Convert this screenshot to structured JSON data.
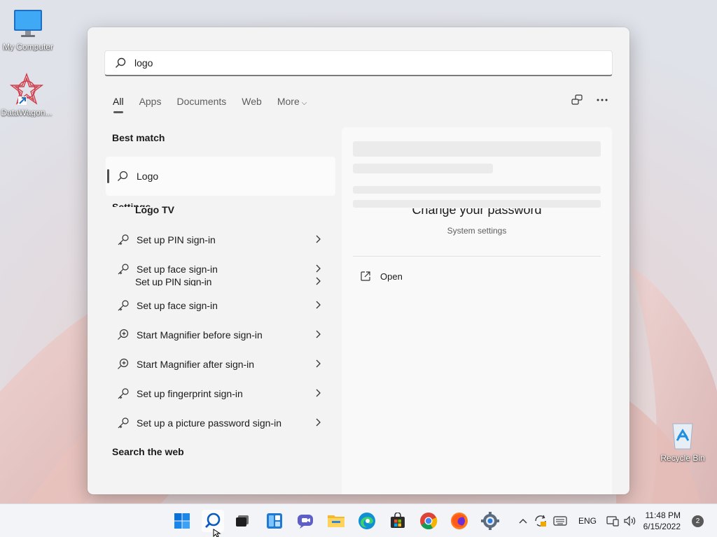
{
  "desktop": {
    "icons": [
      {
        "label": "My Computer",
        "icon": "monitor-icon"
      },
      {
        "label": "DataWagon...",
        "icon": "datawagon-icon"
      },
      {
        "label": "Recycle Bin",
        "icon": "recycle-bin-icon"
      }
    ]
  },
  "search": {
    "query": "logo",
    "tabs": [
      {
        "label": "All",
        "active": true
      },
      {
        "label": "Apps"
      },
      {
        "label": "Documents"
      },
      {
        "label": "Web"
      },
      {
        "label": "More"
      }
    ],
    "top_actions": [
      "share-screen-icon",
      "more-options-icon"
    ],
    "best_match": {
      "heading": "Best match",
      "label": "Logo",
      "ghost_label": "Logo TV"
    },
    "settings_heading_ghost": "Settings",
    "settings_items": [
      {
        "label": "Set up PIN sign-in",
        "icon": "key-icon"
      },
      {
        "label": "Set up face sign-in",
        "icon": "key-icon"
      },
      {
        "label": "Set up face sign-in",
        "icon": "key-icon"
      },
      {
        "label": "Start Magnifier before sign-in",
        "icon": "zoom-in-icon"
      },
      {
        "label": "Start Magnifier after sign-in",
        "icon": "zoom-in-icon"
      },
      {
        "label": "Set up fingerprint sign-in",
        "icon": "key-icon"
      },
      {
        "label": "Set up a picture password sign-in",
        "icon": "key-icon"
      }
    ],
    "ghost_row": "Set up PIN sign-in",
    "web_heading": "Search the web",
    "preview": {
      "title_ghost": "Change your password",
      "subtitle": "System settings",
      "open_label": "Open"
    }
  },
  "taskbar": {
    "apps": [
      "start-icon",
      "search-icon",
      "task-view-icon",
      "widgets-icon",
      "chat-icon",
      "file-explorer-icon",
      "edge-icon",
      "store-icon",
      "chrome-icon",
      "firefox-icon",
      "settings-icon"
    ],
    "language": "ENG",
    "time": "11:48 PM",
    "date": "6/15/2022",
    "notification_count": "2"
  }
}
